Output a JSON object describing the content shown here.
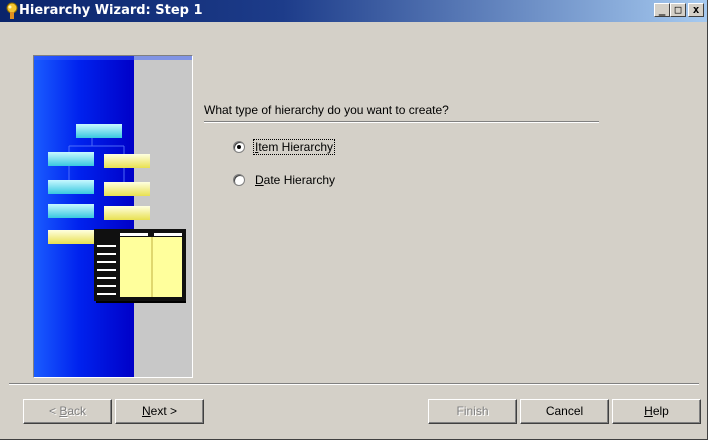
{
  "window": {
    "title": "Hierarchy Wizard: Step 1",
    "controls": {
      "minimize": "_",
      "maximize": "□",
      "close": "x"
    }
  },
  "main": {
    "question": "What type of hierarchy do you want to create?",
    "options": [
      {
        "label": "Item Hierarchy",
        "accel": "I",
        "rest": "tem Hierarchy",
        "selected": true
      },
      {
        "label": "Date Hierarchy",
        "accel": "D",
        "rest": "ate Hierarchy",
        "selected": false
      }
    ]
  },
  "buttons": {
    "back": {
      "prefix": "< ",
      "accel": "B",
      "rest": "ack",
      "enabled": false
    },
    "next": {
      "accel": "N",
      "rest": "ext >",
      "enabled": true
    },
    "finish": {
      "label": "Finish",
      "enabled": false
    },
    "cancel": {
      "label": "Cancel",
      "enabled": true
    },
    "help": {
      "accel": "H",
      "rest": "elp",
      "enabled": true
    }
  },
  "colors": {
    "dialog_bg": "#d4d0c8",
    "titlebar_start": "#0a246a",
    "titlebar_end": "#a6caf0",
    "illustration_blue": "#0000e0",
    "node_cyan": "#7fe8f0",
    "node_yellow": "#ffffa0"
  }
}
